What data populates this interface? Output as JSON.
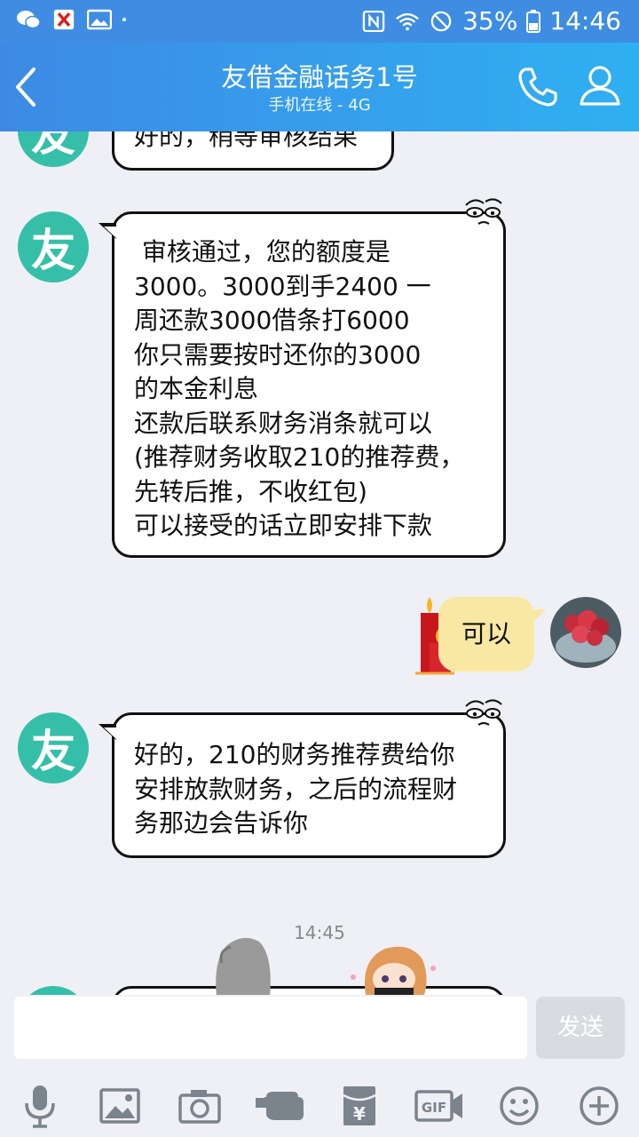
{
  "status_bar": {
    "battery": "35%",
    "time": "14:46"
  },
  "header": {
    "title": "友借金融话务1号",
    "subtitle": "手机在线 - 4G"
  },
  "messages": [
    {
      "sender": "contact",
      "avatar_text": "友",
      "lines": [
        "好的，稍等审核结果"
      ]
    },
    {
      "sender": "contact",
      "avatar_text": "友",
      "lines": [
        " 审核通过，您的额度是",
        "3000。3000到手2400 一",
        "周还款3000借条打6000",
        "你只需要按时还你的3000",
        "的本金利息",
        "还款后联系财务消条就可以",
        "(推荐财务收取210的推荐费，",
        "先转后推，不收红包)",
        "可以接受的话立即安排下款"
      ]
    },
    {
      "sender": "me",
      "lines": [
        "可以"
      ]
    },
    {
      "sender": "contact",
      "avatar_text": "友",
      "lines": [
        "好的，210的财务推荐费给你",
        "安排放款财务，之后的流程财",
        "务那边会告诉你"
      ]
    }
  ],
  "timestamp": "14:45",
  "input": {
    "value": "",
    "send_label": "发送"
  },
  "toolbar": {
    "gif_label": "GIF"
  },
  "colors": {
    "header_start": "#3d8ae4",
    "header_end": "#2fb0f2",
    "contact_avatar": "#36bfa8",
    "my_bubble": "#f9e8a3",
    "chat_bg": "#eef0f5"
  }
}
